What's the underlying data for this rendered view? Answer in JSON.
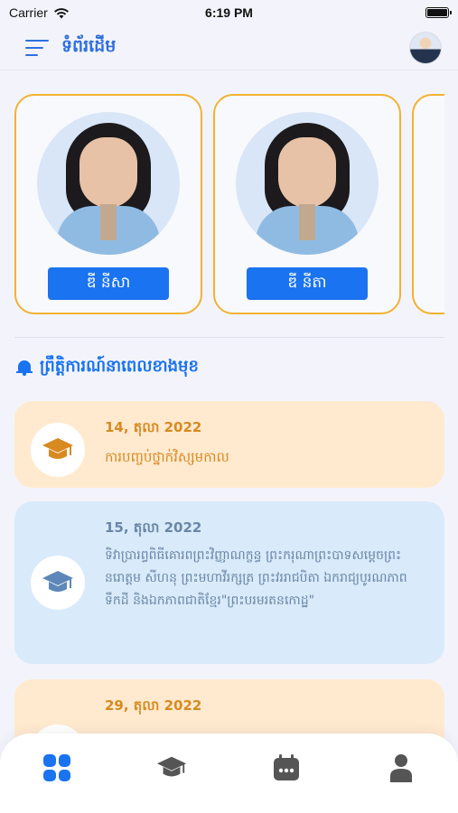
{
  "status_bar": {
    "carrier": "Carrier",
    "time": "6:19 PM"
  },
  "header": {
    "title": "ទំព័រដើម"
  },
  "students": [
    {
      "name": "ឌី នីសា"
    },
    {
      "name": "ឌី នីតា"
    }
  ],
  "events_section": {
    "title": "ព្រឹត្តិការណ៍នាពេលខាងមុខ"
  },
  "events": [
    {
      "date": "14, តុលា 2022",
      "text": "ការបញ្ចប់ថ្នាក់វិស្សមកាល",
      "theme": "orange"
    },
    {
      "date": "15, តុលា 2022",
      "text": "ទិវាប្រារព្ធពិធីគោរពព្រះវិញ្ញាណក្ខន្ធ ព្រះករុណាព្រះបាទសម្តេចព្រះនរោត្តម សីហនុ ព្រះមហាវីរក្សត្រ ព្រះវររាជបិតា ឯករាជ្យបូរណភាពទឹកដី និងឯកភាពជាតិខ្មែរ\"ព្រះបរមរតនកោដ្ឋ\"",
      "theme": "blue"
    },
    {
      "date": "29, តុលា 2022",
      "text": "",
      "theme": "orange"
    }
  ],
  "bottom_nav": [
    "home-icon",
    "graduation-cap-icon",
    "calendar-icon",
    "person-icon"
  ],
  "colors": {
    "primary": "#1a73f0",
    "card_border": "#f2b233",
    "orange_card": "#ffead0",
    "blue_card": "#d9eafb"
  }
}
